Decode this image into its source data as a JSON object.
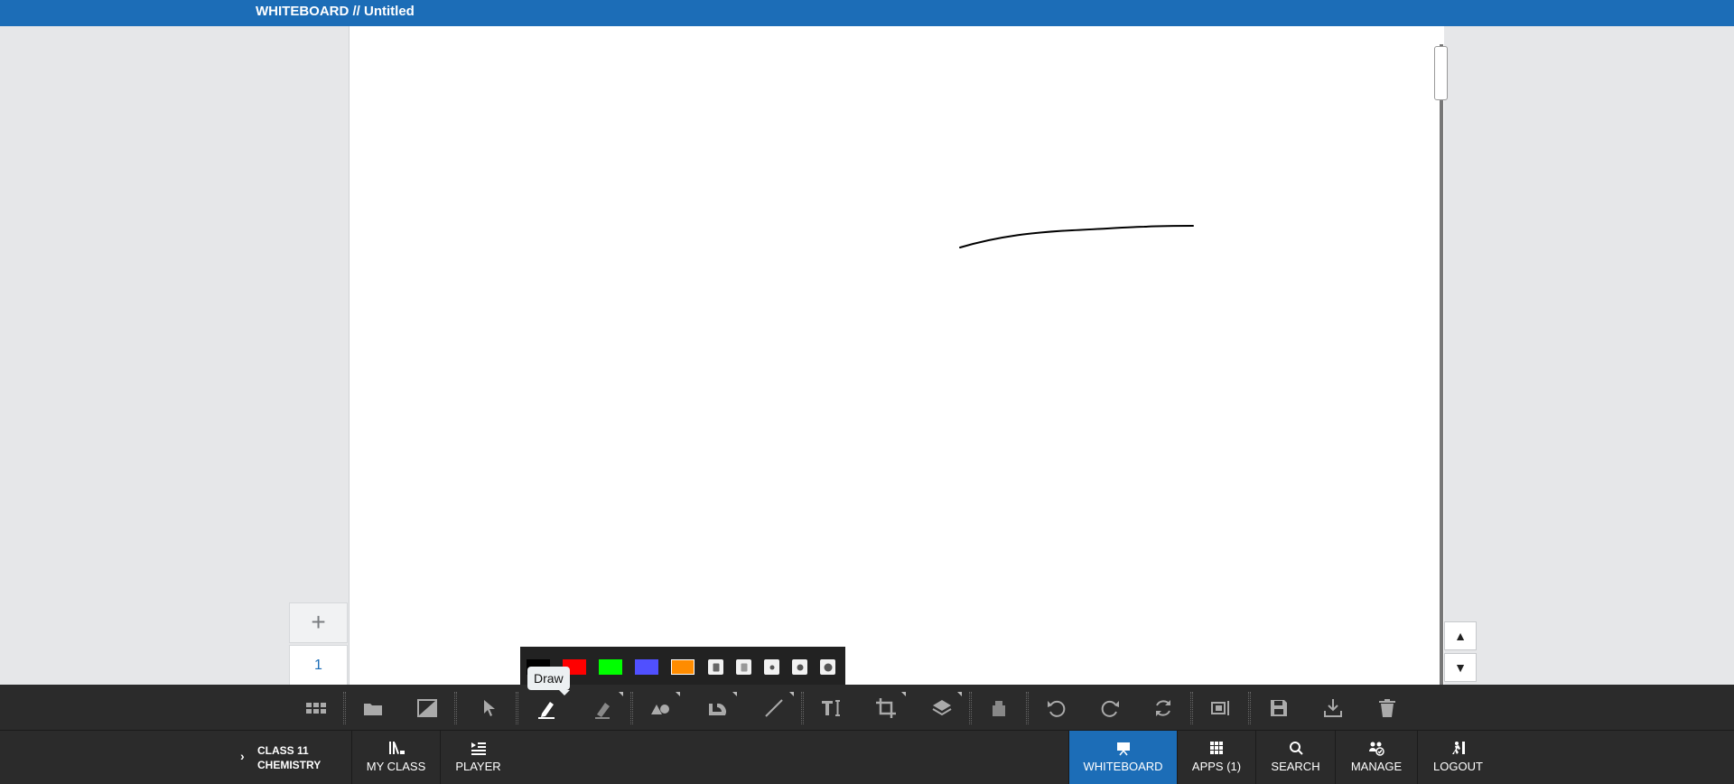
{
  "title_bar": {
    "title": "WHITEBOARD // Untitled"
  },
  "pages": {
    "add_label": "+",
    "current_page": "1"
  },
  "page_scroll": {
    "up": "▲",
    "down": "▼"
  },
  "tooltip": {
    "text": "Draw"
  },
  "pen_colors": [
    {
      "name": "black",
      "hex": "#000000"
    },
    {
      "name": "red",
      "hex": "#ff0000"
    },
    {
      "name": "green",
      "hex": "#00ff00"
    },
    {
      "name": "blue",
      "hex": "#5050ff"
    },
    {
      "name": "orange",
      "hex": "#ff8c00",
      "selected": true
    }
  ],
  "toolbar_icons": [
    "grid-icon",
    "folder-icon",
    "background-icon",
    "pointer-icon",
    "pen-icon",
    "highlighter-icon",
    "shapes-icon",
    "protractor-icon",
    "line-icon",
    "text-icon",
    "crop-icon",
    "layers-icon",
    "eraser-icon",
    "undo-icon",
    "redo-icon",
    "refresh-icon",
    "fit-screen-icon",
    "save-icon",
    "download-icon",
    "delete-icon"
  ],
  "bottom_nav": {
    "class_line1": "CLASS 11",
    "class_line2": "CHEMISTRY",
    "my_class": "MY CLASS",
    "player": "PLAYER",
    "whiteboard": "WHITEBOARD",
    "apps": "APPS (1)",
    "search": "SEARCH",
    "manage": "MANAGE",
    "logout": "LOGOUT"
  },
  "colors": {
    "accent": "#1c6db7",
    "toolbar_bg": "#2b2b2b",
    "canvas_bg": "#ffffff",
    "side_bg": "#e6e7e9"
  }
}
